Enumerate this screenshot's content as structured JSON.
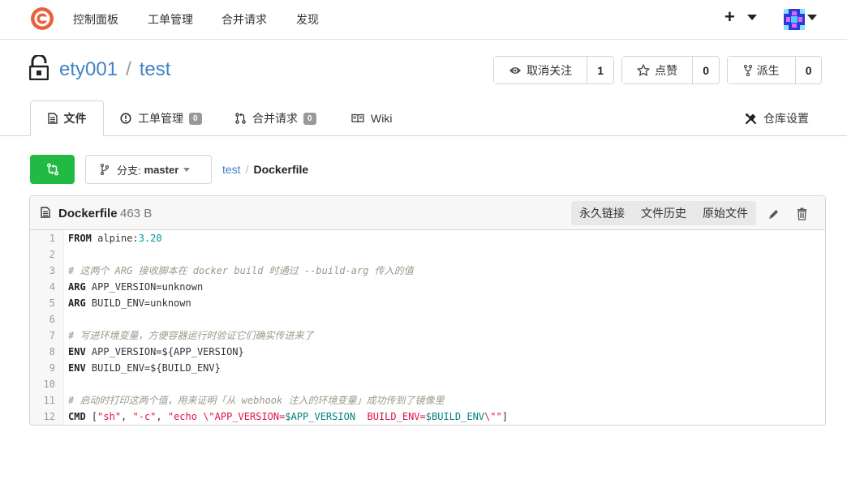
{
  "nav": {
    "items": [
      "控制面板",
      "工单管理",
      "合并请求",
      "发现"
    ],
    "plus": "+"
  },
  "repo": {
    "owner": "ety001",
    "separator": "/",
    "name": "test"
  },
  "actions": {
    "watch": {
      "label": "取消关注",
      "count": "1"
    },
    "star": {
      "label": "点赞",
      "count": "0"
    },
    "fork": {
      "label": "派生",
      "count": "0"
    }
  },
  "tabs": {
    "files": "文件",
    "issues": {
      "label": "工单管理",
      "count": "0"
    },
    "pulls": {
      "label": "合并请求",
      "count": "0"
    },
    "wiki": "Wiki",
    "settings": "仓库设置"
  },
  "branch": {
    "label": "分支:",
    "name": "master"
  },
  "breadcrumb": {
    "root": "test",
    "divider": "/",
    "current": "Dockerfile"
  },
  "file": {
    "name": "Dockerfile",
    "size": "463 B",
    "permalink": "永久链接",
    "history": "文件历史",
    "raw": "原始文件"
  },
  "code": {
    "line_numbers": [
      "1",
      "2",
      "3",
      "4",
      "5",
      "6",
      "7",
      "8",
      "9",
      "10",
      "11",
      "12"
    ],
    "l1_kw": "FROM",
    "l1_rest": " alpine:",
    "l1_ver": "3.20",
    "l3": "# 这两个 ARG 接收脚本在 docker build 时通过 --build-arg 传入的值",
    "l4_kw": "ARG",
    "l4_rest": " APP_VERSION=unknown",
    "l5_kw": "ARG",
    "l5_rest": " BUILD_ENV=unknown",
    "l7": "# 写进环境变量，方便容器运行时验证它们确实传进来了",
    "l8_kw": "ENV",
    "l8_rest": " APP_VERSION=${APP_VERSION}",
    "l9_kw": "ENV",
    "l9_rest": " BUILD_ENV=${BUILD_ENV}",
    "l11": "# 启动时打印这两个值，用来证明「从 webhook 注入的环境变量」成功传到了镜像里",
    "l12_kw": "CMD",
    "l12_a": " [",
    "l12_s1": "\"sh\"",
    "l12_c1": ", ",
    "l12_s2": "\"-c\"",
    "l12_c2": ", ",
    "l12_s3a": "\"echo \\\"APP_VERSION=",
    "l12_v1": "$APP_VERSION",
    "l12_s3b": "  BUILD_ENV=",
    "l12_v2": "$BUILD_ENV",
    "l12_s3c": "\\\"\"",
    "l12_z": "]"
  }
}
